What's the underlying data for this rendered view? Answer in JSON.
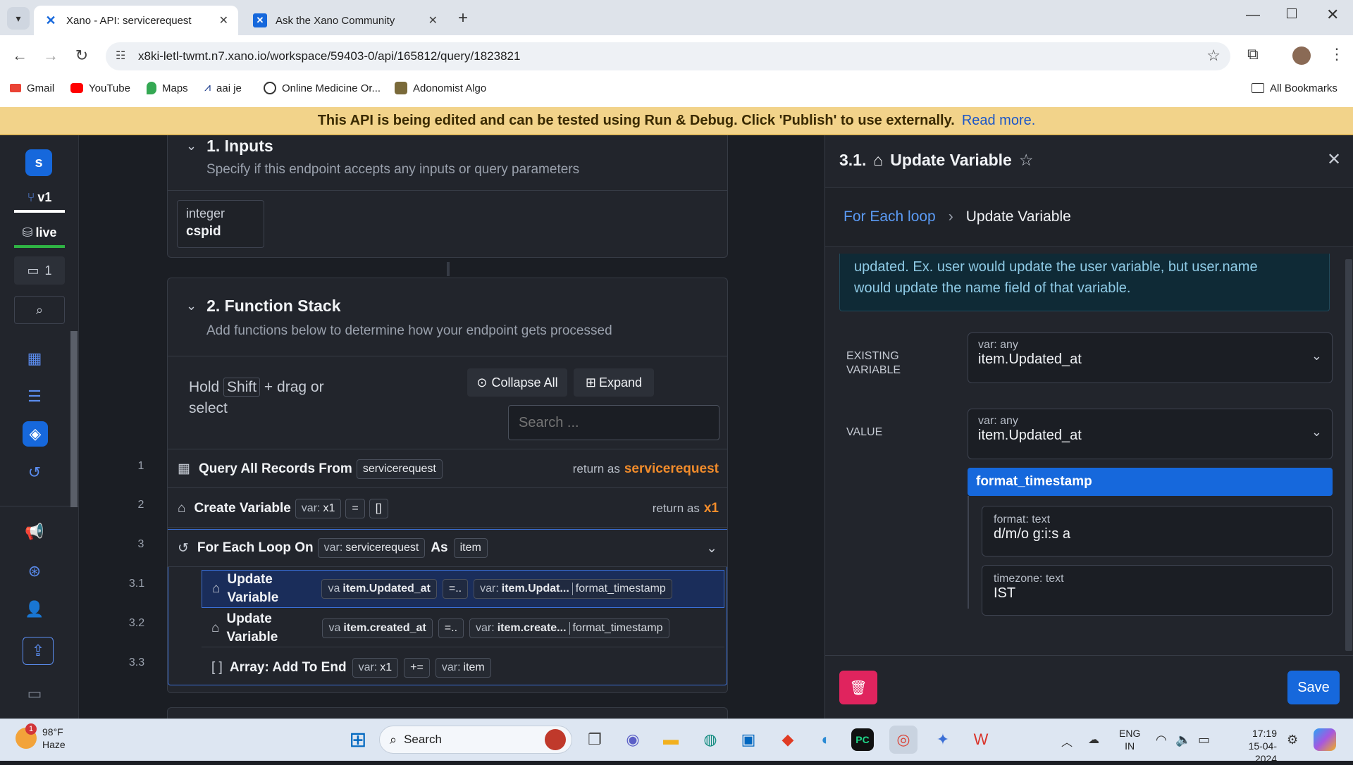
{
  "browser": {
    "tabs": [
      {
        "label": "Xano - API: servicerequest",
        "active": true
      },
      {
        "label": "Ask the Xano Community",
        "active": false
      }
    ],
    "url": "x8ki-letl-twmt.n7.xano.io/workspace/59403-0/api/165812/query/1823821",
    "bookmarks": [
      "Gmail",
      "YouTube",
      "Maps",
      "aai je",
      "Online Medicine Or...",
      "Adonomist Algo"
    ],
    "all_bookmarks": "All Bookmarks"
  },
  "banner": {
    "text": "This API is being edited and can be tested using Run & Debug. Click 'Publish' to use externally.",
    "link": "Read more."
  },
  "rail": {
    "workspace_initial": "s",
    "branch": "v1",
    "datasource": "live",
    "comments": "1"
  },
  "inputs": {
    "title": "1. Inputs",
    "subtitle": "Specify if this endpoint accepts any inputs or query parameters",
    "field_type": "integer",
    "field_name": "cspid"
  },
  "stack": {
    "title": "2. Function Stack",
    "subtitle": "Add functions below to determine how your endpoint gets processed",
    "hint_prefix": "Hold",
    "hint_key": "Shift",
    "hint_suffix": "+ drag or",
    "hint_line2": "select",
    "collapse_all": "Collapse All",
    "expand": "Expand",
    "search_placeholder": "Search ...",
    "rows": [
      {
        "num": "1",
        "name": "Query All Records From",
        "chip": "servicerequest",
        "return_label": "return as",
        "return_value": "servicerequest"
      },
      {
        "num": "2",
        "name": "Create Variable",
        "chip_var": "var:",
        "chip_name": "x1",
        "op": "=",
        "value": "[]",
        "return_label": "return as",
        "return_value": "x1"
      },
      {
        "num": "3",
        "name": "For Each Loop On",
        "chip_var": "var:",
        "chip_name": "servicerequest",
        "as": "As",
        "item": "item"
      },
      {
        "num": "3.1",
        "name1": "Update",
        "name2": "Variable",
        "chip_var": "va",
        "chip_name": "item.Updated_at",
        "op": "=..",
        "rhs_var": "var:",
        "rhs_name": "item.Updat...",
        "filter": "format_timestamp"
      },
      {
        "num": "3.2",
        "name1": "Update",
        "name2": "Variable",
        "chip_var": "va",
        "chip_name": "item.created_at",
        "op": "=..",
        "rhs_var": "var:",
        "rhs_name": "item.create...",
        "filter": "format_timestamp"
      },
      {
        "num": "3.3",
        "name": "Array: Add To End",
        "chip_var": "var:",
        "chip_name": "x1",
        "op": "+=",
        "rhs_var": "var:",
        "rhs_name": "item"
      }
    ]
  },
  "panel": {
    "title_num": "3.1.",
    "title": "Update Variable",
    "breadcrumb_parent": "For Each loop",
    "breadcrumb_current": "Update Variable",
    "info_line1": "updated. Ex. user would update the user variable, but user.name",
    "info_line2": "would update the name field of that variable.",
    "existing_label_1": "EXISTING",
    "existing_label_2": "VARIABLE",
    "existing_type": "var: any",
    "existing_value": "item.Updated_at",
    "value_label": "VALUE",
    "value_type": "var: any",
    "value_value": "item.Updated_at",
    "filter_name": "format_timestamp",
    "format_label": "format: text",
    "format_value": "d/m/o g:i:s a",
    "timezone_label": "timezone: text",
    "timezone_value": "IST",
    "save": "Save"
  },
  "taskbar": {
    "weather_temp": "98°F",
    "weather_desc": "Haze",
    "weather_badge": "1",
    "search": "Search",
    "lang1": "ENG",
    "lang2": "IN",
    "time": "17:19",
    "date": "15-04-2024"
  },
  "colors": {
    "accent": "#1668dc",
    "orange": "#f28c2b",
    "banner": "#f2d38a",
    "delete": "#e0245e"
  }
}
